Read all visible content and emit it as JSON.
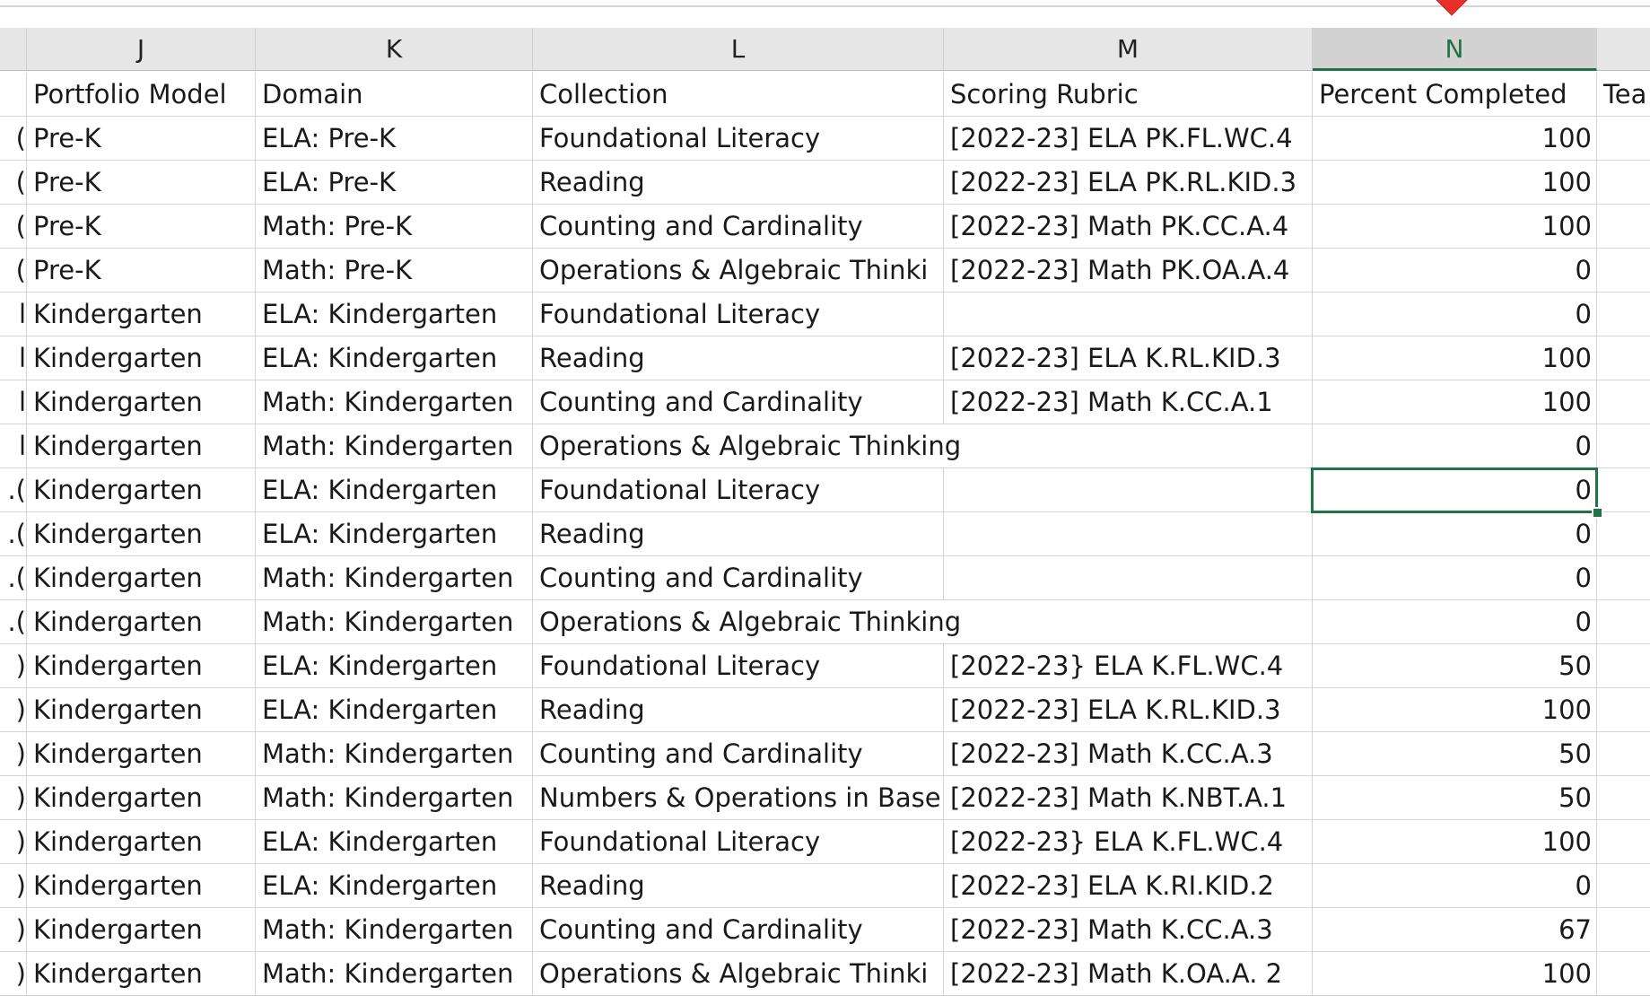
{
  "sheet": {
    "columns": [
      {
        "letter": "J",
        "header": "Portfolio Model"
      },
      {
        "letter": "K",
        "header": "Domain"
      },
      {
        "letter": "L",
        "header": "Collection"
      },
      {
        "letter": "M",
        "header": "Scoring Rubric"
      },
      {
        "letter": "N",
        "header": "Percent Completed"
      },
      {
        "letter": "",
        "header": "Tea"
      }
    ],
    "selected_column": "N",
    "rows": [
      {
        "prefix": "(",
        "model": "Pre-K",
        "domain": "ELA: Pre-K",
        "collection": "Foundational Literacy",
        "rubric": "[2022-23] ELA PK.FL.WC.4",
        "percent": "100"
      },
      {
        "prefix": "(",
        "model": "Pre-K",
        "domain": "ELA: Pre-K",
        "collection": "Reading",
        "rubric": "[2022-23] ELA PK.RL.KID.3",
        "percent": "100"
      },
      {
        "prefix": "(",
        "model": "Pre-K",
        "domain": "Math: Pre-K",
        "collection": "Counting and Cardinality",
        "rubric": "[2022-23] Math PK.CC.A.4",
        "percent": "100"
      },
      {
        "prefix": "(",
        "model": "Pre-K",
        "domain": "Math: Pre-K",
        "collection": "Operations & Algebraic Thinki",
        "rubric": "[2022-23] Math PK.OA.A.4",
        "percent": "0"
      },
      {
        "prefix": "l",
        "model": "Kindergarten",
        "domain": "ELA: Kindergarten",
        "collection": "Foundational Literacy",
        "rubric": "",
        "percent": "0"
      },
      {
        "prefix": "l",
        "model": "Kindergarten",
        "domain": "ELA: Kindergarten",
        "collection": "Reading",
        "rubric": "[2022-23] ELA K.RL.KID.3",
        "percent": "100"
      },
      {
        "prefix": "l",
        "model": "Kindergarten",
        "domain": "Math: Kindergarten",
        "collection": "Counting and Cardinality",
        "rubric": "[2022-23] Math K.CC.A.1",
        "percent": "100"
      },
      {
        "prefix": "l",
        "model": "Kindergarten",
        "domain": "Math: Kindergarten",
        "collection": "Operations & Algebraic Thinking",
        "rubric": "",
        "percent": "0"
      },
      {
        "prefix": ".(",
        "model": "Kindergarten",
        "domain": "ELA: Kindergarten",
        "collection": "Foundational Literacy",
        "rubric": "",
        "percent": "0"
      },
      {
        "prefix": ".(",
        "model": "Kindergarten",
        "domain": "ELA: Kindergarten",
        "collection": "Reading",
        "rubric": "",
        "percent": "0"
      },
      {
        "prefix": ".(",
        "model": "Kindergarten",
        "domain": "Math: Kindergarten",
        "collection": "Counting and Cardinality",
        "rubric": "",
        "percent": "0"
      },
      {
        "prefix": ".(",
        "model": "Kindergarten",
        "domain": "Math: Kindergarten",
        "collection": "Operations & Algebraic Thinking",
        "rubric": "",
        "percent": "0"
      },
      {
        "prefix": ")",
        "model": "Kindergarten",
        "domain": "ELA: Kindergarten",
        "collection": "Foundational Literacy",
        "rubric": "[2022-23} ELA K.FL.WC.4",
        "percent": "50"
      },
      {
        "prefix": ")",
        "model": "Kindergarten",
        "domain": "ELA: Kindergarten",
        "collection": "Reading",
        "rubric": "[2022-23] ELA K.RL.KID.3",
        "percent": "100"
      },
      {
        "prefix": ")",
        "model": "Kindergarten",
        "domain": "Math: Kindergarten",
        "collection": "Counting and Cardinality",
        "rubric": "[2022-23] Math K.CC.A.3",
        "percent": "50"
      },
      {
        "prefix": ")",
        "model": "Kindergarten",
        "domain": "Math: Kindergarten",
        "collection": "Numbers & Operations in Base",
        "rubric": "[2022-23] Math K.NBT.A.1",
        "percent": "50"
      },
      {
        "prefix": ")",
        "model": "Kindergarten",
        "domain": "ELA: Kindergarten",
        "collection": "Foundational Literacy",
        "rubric": "[2022-23} ELA K.FL.WC.4",
        "percent": "100"
      },
      {
        "prefix": ")",
        "model": "Kindergarten",
        "domain": "ELA: Kindergarten",
        "collection": "Reading",
        "rubric": "[2022-23] ELA K.RI.KID.2",
        "percent": "0"
      },
      {
        "prefix": ")",
        "model": "Kindergarten",
        "domain": "Math: Kindergarten",
        "collection": "Counting and Cardinality",
        "rubric": "[2022-23] Math K.CC.A.3",
        "percent": "67"
      },
      {
        "prefix": ")",
        "model": "Kindergarten",
        "domain": "Math: Kindergarten",
        "collection": "Operations & Algebraic Thinki",
        "rubric": "[2022-23] Math K.OA.A. 2",
        "percent": "100"
      }
    ],
    "active_row": 8,
    "colors": {
      "selection": "#217346",
      "marker": "#e8302a"
    }
  }
}
